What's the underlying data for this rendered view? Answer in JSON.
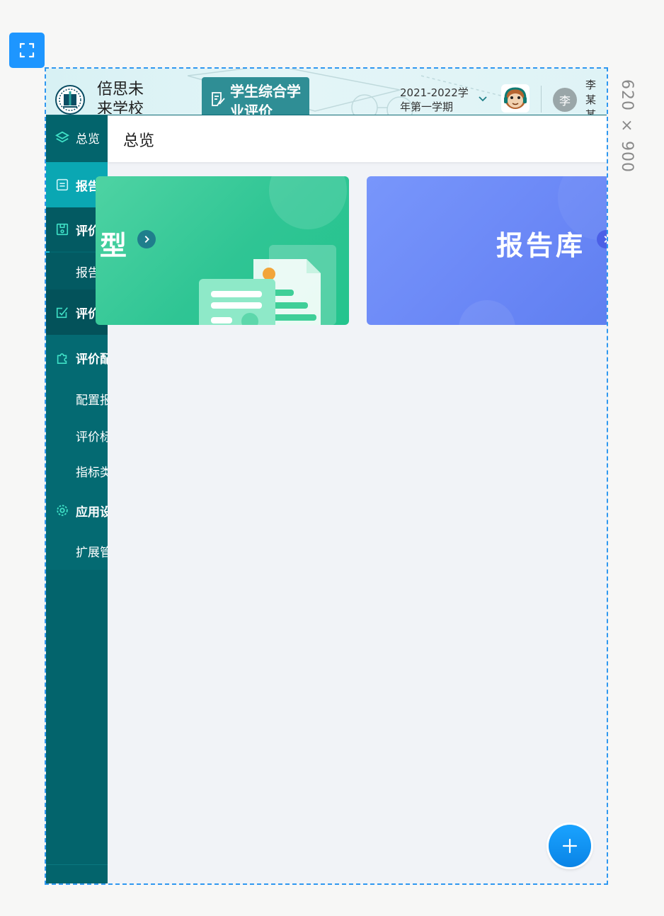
{
  "canvas_label": "620 × 900",
  "header": {
    "school_name": "倍思未来学校",
    "app_title": "学生综合学业评价",
    "term": "2021-2022学年第一学期",
    "user_avatar_char": "李",
    "user_name": "李某某"
  },
  "sidebar": {
    "items": [
      {
        "label": "总览",
        "icon": "layers-icon"
      },
      {
        "label": "报告模型",
        "icon": "report-icon"
      },
      {
        "label": "评价报告",
        "icon": "calendar-report-icon"
      },
      {
        "label": "报告管理"
      },
      {
        "label": "评价填写",
        "icon": "edit-icon"
      },
      {
        "label": "评价配置",
        "icon": "puzzle-icon"
      },
      {
        "label": "配置报告"
      },
      {
        "label": "评价标准"
      },
      {
        "label": "指标类型"
      },
      {
        "label": "应用设置",
        "icon": "gear-icon"
      },
      {
        "label": "扩展管理"
      }
    ]
  },
  "tab": {
    "title": "总览"
  },
  "cards": [
    {
      "label": "型",
      "color": "#2fc594"
    },
    {
      "label": "报告库",
      "color": "#6a87f6"
    }
  ],
  "fab": {
    "icon": "plus-icon",
    "color": "#0a84e6"
  },
  "colors": {
    "sidebar": "#03646c",
    "accent": "#19c3d6",
    "selection": "#1e96ff"
  }
}
